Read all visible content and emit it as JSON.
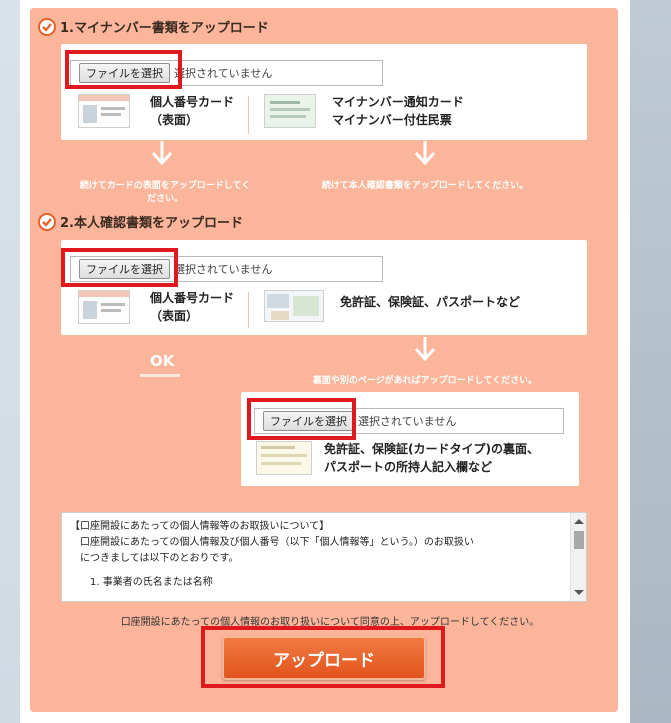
{
  "section1": {
    "title": "1.マイナンバー書類をアップロード",
    "file_button": "ファイルを選択",
    "file_status": "選択されていません",
    "doc_left_line1": "個人番号カード",
    "doc_left_line2": "（表面）",
    "doc_right_line1": "マイナンバー通知カード",
    "doc_right_line2": "マイナンバー付住民票",
    "note_left_line1": "続けてカードの表面をアップロードしてく",
    "note_left_line2": "ださい。",
    "note_right": "続けて本人確認書類をアップロードしてください。"
  },
  "section2": {
    "title": "2.本人確認書類をアップロード",
    "file_button": "ファイルを選択",
    "file_status": "選択されていません",
    "doc_left_line1": "個人番号カード",
    "doc_left_line2": "（表面）",
    "doc_right": "免許証、保険証、パスポートなど",
    "ok": "OK",
    "note_right": "裏面や別のページがあればアップロードしてください。",
    "sub_file_button": "ファイルを選択",
    "sub_file_status": "選択されていません",
    "sub_doc_line1": "免許証、保険証(カードタイプ)の裏面、",
    "sub_doc_line2": "パスポートの所持人記入欄など"
  },
  "terms": {
    "line1": "【口座開設にあたっての個人情報等のお取扱いについて】",
    "line2": "口座開設にあたっての個人情報及び個人番号（以下「個人情報等」という。）のお取扱い",
    "line3": "につきましては以下のとおりです。",
    "line4": "1. 事業者の氏名または名称"
  },
  "consent_text": "口座開設にあたっての個人情報のお取り扱いについて同意の上、アップロードしてください。",
  "upload_button": "アップロード",
  "colors": {
    "panel": "#fbb59a",
    "accent": "#e2541c",
    "highlight_outline": "#e0191f"
  }
}
